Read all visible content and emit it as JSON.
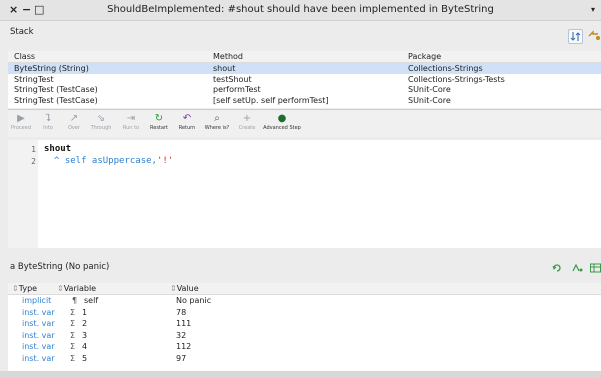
{
  "window": {
    "title": "ShouldBeImplemented: #shout should have been implemented in ByteString",
    "close_glyph": "×",
    "minimize_glyph": "−",
    "maximize_glyph": "□",
    "menu_glyph": "▾"
  },
  "stack": {
    "label": "Stack",
    "columns": {
      "class": "Class",
      "method": "Method",
      "package": "Package"
    },
    "rows": [
      {
        "class": "ByteString (String)",
        "method": "shout",
        "package": "Collections-Strings"
      },
      {
        "class": "StringTest",
        "method": "testShout",
        "package": "Collections-Strings-Tests"
      },
      {
        "class": "StringTest (TestCase)",
        "method": "performTest",
        "package": "SUnit-Core"
      },
      {
        "class": "StringTest (TestCase)",
        "method": "[self setUp. self performTest]",
        "package": "SUnit-Core"
      }
    ],
    "icons": [
      "sort-icon",
      "browse-icon"
    ]
  },
  "toolbar": {
    "buttons": [
      {
        "label": "Proceed",
        "icon": "▶",
        "enabled": false
      },
      {
        "label": "Into",
        "icon": "⮧",
        "enabled": false
      },
      {
        "label": "Over",
        "icon": "↗",
        "enabled": false
      },
      {
        "label": "Through",
        "icon": "⇘",
        "enabled": false
      },
      {
        "label": "Run to",
        "icon": "⇥",
        "enabled": false
      },
      {
        "label": "Restart",
        "icon": "↻",
        "enabled": true
      },
      {
        "label": "Return",
        "icon": "↶",
        "enabled": true
      },
      {
        "label": "Where is?",
        "icon": "⌕",
        "enabled": true
      },
      {
        "label": "Create",
        "icon": "+",
        "enabled": false
      },
      {
        "label": "Advanced Step",
        "icon": "●",
        "enabled": true
      }
    ]
  },
  "code": {
    "line_numbers": [
      "1",
      "2"
    ],
    "method_name": "shout",
    "line2": "^ self asUppercase,'!'"
  },
  "inspector": {
    "label": "a ByteString (No panic)",
    "columns": {
      "type": "Type",
      "variable": "Variable",
      "value": "Value"
    },
    "rows": [
      {
        "type": "implicit",
        "symbol": "¶",
        "variable": "self",
        "value": "No panic"
      },
      {
        "type": "inst. var",
        "symbol": "Σ",
        "variable": "1",
        "value": "78"
      },
      {
        "type": "inst. var",
        "symbol": "Σ",
        "variable": "2",
        "value": "111"
      },
      {
        "type": "inst. var",
        "symbol": "Σ",
        "variable": "3",
        "value": "32"
      },
      {
        "type": "inst. var",
        "symbol": "Σ",
        "variable": "4",
        "value": "112"
      },
      {
        "type": "inst. var",
        "symbol": "Σ",
        "variable": "5",
        "value": "97"
      }
    ]
  },
  "colors": {
    "selection": "#cfe0f7",
    "type_text": "#2f7fd3",
    "string_literal": "#c03030",
    "keyword": "#2f7fd3"
  }
}
